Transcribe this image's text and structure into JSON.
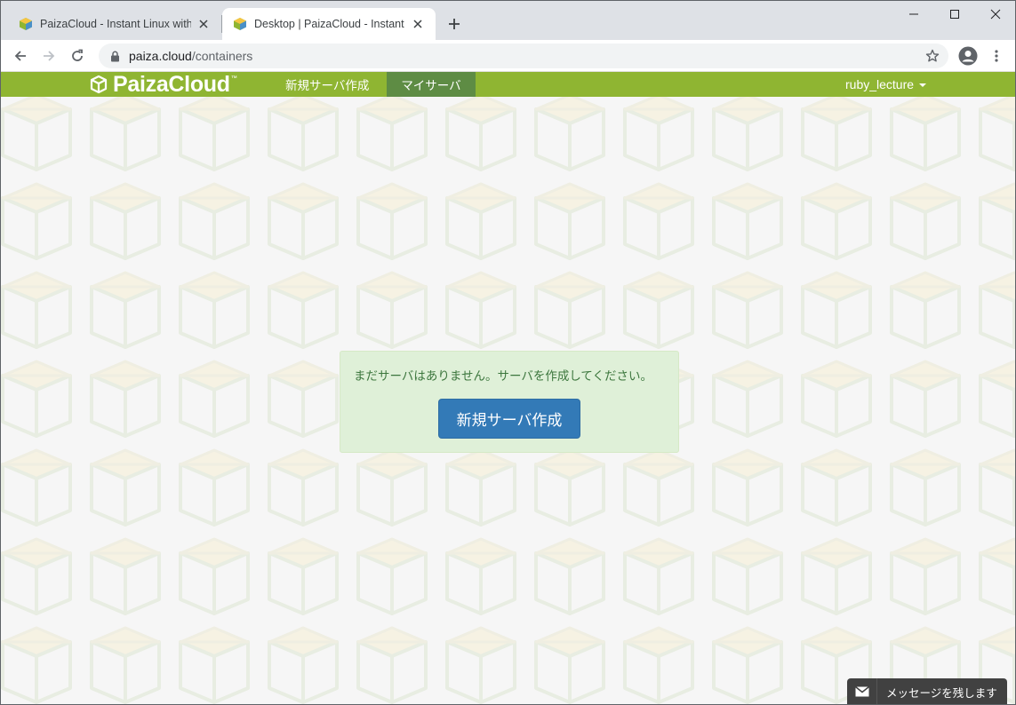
{
  "browser": {
    "tabs": [
      {
        "title": "PaizaCloud - Instant Linux with W",
        "active": false
      },
      {
        "title": "Desktop | PaizaCloud - Instant Lin",
        "active": true
      }
    ],
    "address": {
      "host": "paiza.cloud",
      "path": "/containers"
    }
  },
  "navbar": {
    "brand": "PaizaCloud",
    "brand_tm": "™",
    "links": {
      "new_server": "新規サーバ作成",
      "my_server": "マイサーバ"
    },
    "user": "ruby_lecture",
    "color": "#8fb532",
    "active_color": "#5e8c44"
  },
  "main": {
    "empty_message": "まだサーバはありません。サーバを作成してください。",
    "create_button": "新規サーバ作成"
  },
  "message_widget": {
    "label": "メッセージを残します"
  }
}
